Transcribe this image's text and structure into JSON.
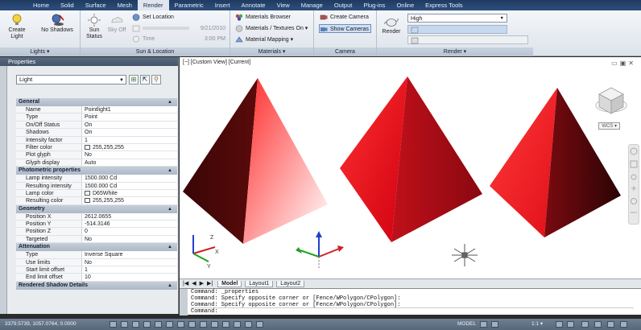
{
  "tabs": [
    "Home",
    "Solid",
    "Surface",
    "Mesh",
    "Render",
    "Parametric",
    "Insert",
    "Annotate",
    "View",
    "Manage",
    "Output",
    "Plug-ins",
    "Online",
    "Express Tools"
  ],
  "active_tab": "Render",
  "ribbon": {
    "lights": {
      "title": "Lights ▾",
      "create_light": "Create Light",
      "no_shadows": "No Shadows"
    },
    "sun": {
      "title": "Sun & Location",
      "sun_status": "Sun Status",
      "sky_off": "Sky Off",
      "set_location": "Set Location",
      "date": "9/21/2010",
      "time_label": "Time",
      "time": "3:00 PM"
    },
    "materials": {
      "title": "Materials ▾",
      "browser": "Materials Browser",
      "textures": "Materials / Textures On ▾",
      "mapping": "Material Mapping ▾"
    },
    "camera": {
      "title": "Camera",
      "create": "Create Camera",
      "show": "Show Cameras"
    },
    "render": {
      "title": "Render ▾",
      "render_label": "Render",
      "quality": "High"
    }
  },
  "properties": {
    "title": "Properties",
    "type": "Light",
    "sections": [
      {
        "name": "General",
        "rows": [
          [
            "Name",
            "Pointlight1"
          ],
          [
            "Type",
            "Point"
          ],
          [
            "On/Off Status",
            "On"
          ],
          [
            "Shadows",
            "On"
          ],
          [
            "Intensity factor",
            "1"
          ],
          [
            "Filter color",
            "255,255,255"
          ],
          [
            "Plot glyph",
            "No"
          ],
          [
            "Glyph display",
            "Auto"
          ]
        ]
      },
      {
        "name": "Photometric properties",
        "rows": [
          [
            "Lamp intensity",
            "1500.000 Cd"
          ],
          [
            "Resulting intensity",
            "1500.000 Cd"
          ],
          [
            "Lamp color",
            "D65White"
          ],
          [
            "Resulting color",
            "255,255,255"
          ]
        ]
      },
      {
        "name": "Geometry",
        "rows": [
          [
            "Position X",
            "2612.0655"
          ],
          [
            "Position Y",
            "-514.3146"
          ],
          [
            "Position Z",
            "0"
          ],
          [
            "Targeted",
            "No"
          ]
        ]
      },
      {
        "name": "Attenuation",
        "rows": [
          [
            "Type",
            "Inverse Square"
          ],
          [
            "Use limits",
            "No"
          ],
          [
            "Start limit offset",
            "1"
          ],
          [
            "End limit offset",
            "10"
          ]
        ]
      },
      {
        "name": "Rendered Shadow Details",
        "rows": []
      }
    ]
  },
  "viewport": {
    "label": "[−] [Custom View] [Current]",
    "wcs": "WCS ▾"
  },
  "layout_tabs": [
    "Model",
    "Layout1",
    "Layout2"
  ],
  "command_lines": [
    "Command: _properties",
    "Command: Specify opposite corner or [Fence/WPolygon/CPolygon]:",
    "Command: Specify opposite corner or [Fence/WPolygon/CPolygon]:"
  ],
  "command_prompt": "Command:",
  "status": {
    "coords": "3379.5739, 1057.0764, 0.0000",
    "model": "MODEL",
    "scale": "1:1 ▾"
  },
  "colors": {
    "ribbon_bar": "#2c4f7e",
    "pyramid_red": "#e0101a",
    "pyramid_dark": "#3a0606"
  }
}
